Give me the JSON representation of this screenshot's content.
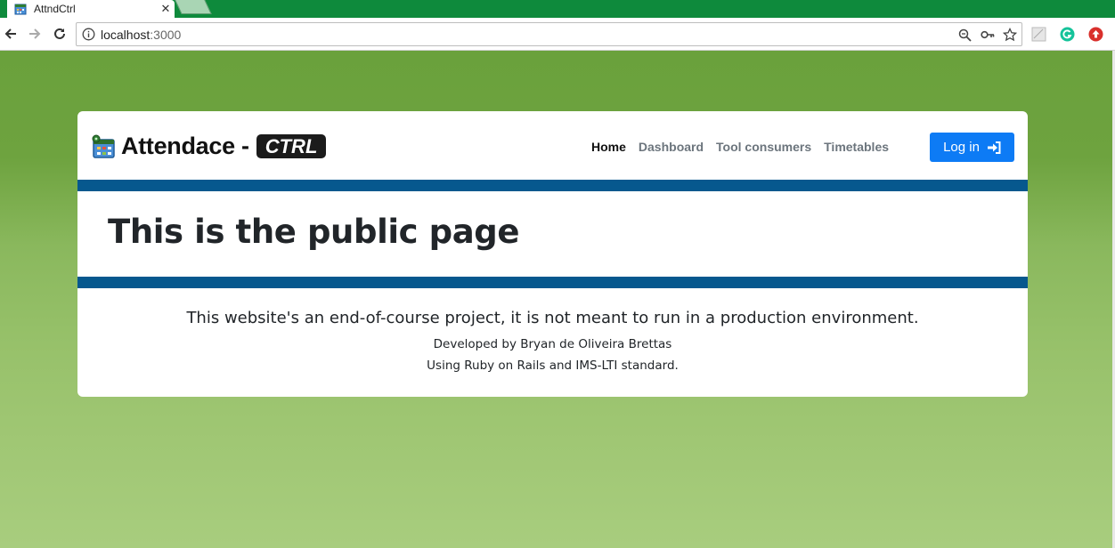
{
  "browser": {
    "tab_title": "AttndCtrl",
    "url_host": "localhost",
    "url_port": ":3000"
  },
  "navbar": {
    "brand_text": "Attendace -",
    "brand_badge": "CTRL",
    "links": [
      "Home",
      "Dashboard",
      "Tool consumers",
      "Timetables"
    ],
    "login_label": "Log in"
  },
  "main": {
    "headline": "This is the public page"
  },
  "footer": {
    "line1": "This website's an end-of-course project, it is not meant to run in a production environment.",
    "line2": "Developed by Bryan de Oliveira Brettas",
    "line3": "Using Ruby on Rails and IMS-LTI standard."
  },
  "colors": {
    "chrome_green": "#0e8a3c",
    "stripe_blue": "#06588e",
    "button_blue": "#0d7bf5",
    "page_green": "#6ea33f"
  },
  "icons": [
    "calendar-icon",
    "close-icon",
    "back-arrow-icon",
    "forward-arrow-icon",
    "reload-icon",
    "info-icon",
    "zoom-icon",
    "key-icon",
    "star-icon",
    "extension-icon",
    "grammarly-icon",
    "adblock-icon",
    "sign-in-icon"
  ]
}
